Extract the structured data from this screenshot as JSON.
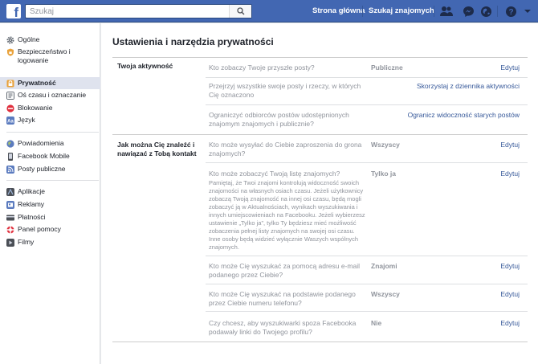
{
  "topbar": {
    "search_placeholder": "Szukaj",
    "nav_home": "Strona główna",
    "nav_find_friends": "Szukaj znajomych"
  },
  "sidebar": {
    "items": [
      {
        "label": "Ogólne"
      },
      {
        "label": "Bezpieczeństwo i logowanie"
      },
      {
        "label": "Prywatność"
      },
      {
        "label": "Oś czasu i oznaczanie"
      },
      {
        "label": "Blokowanie"
      },
      {
        "label": "Język"
      },
      {
        "label": "Powiadomienia"
      },
      {
        "label": "Facebook Mobile"
      },
      {
        "label": "Posty publiczne"
      },
      {
        "label": "Aplikacje"
      },
      {
        "label": "Reklamy"
      },
      {
        "label": "Płatności"
      },
      {
        "label": "Panel pomocy"
      },
      {
        "label": "Filmy"
      }
    ]
  },
  "main": {
    "title": "Ustawienia i narzędzia prywatności",
    "sections": [
      {
        "label": "Twoja aktywność",
        "rows": [
          {
            "question": "Kto zobaczy Twoje przyszłe posty?",
            "value": "Publiczne",
            "action": "Edytuj"
          },
          {
            "question": "Przejrzyj wszystkie swoje posty i rzeczy, w których Cię oznaczono",
            "value": "",
            "action": "Skorzystaj z dziennika aktywności"
          },
          {
            "question": "Ogranicźyć odbiorców postów udostępnionych znajomym znajomych i publicznie?",
            "value": "",
            "action": "Ogranicz widoczność starych postów"
          }
        ]
      },
      {
        "label": "Jak można Cię znaleźć i nawiązać z Tobą kontakt",
        "rows": [
          {
            "question": "Kto może wysyłać do Ciebie zaproszenia do grona znajomych?",
            "value": "Wszyscy",
            "action": "Edytuj"
          },
          {
            "question": "Kto może zobaczyć Twoją listę znajomych?",
            "description": "Pamiętaj, że Twoi znajomi kontrolują widoczność swoich znajomości na własnych osiach czasu. Jeżeli użytkownicy zobaczą Twoją znajomość na innej osi czasu, będą mogli zobaczyć ją w Aktualnościach, wynikach wyszukiwania i innych umiejscowieniach na Facebooku. Jeżeli wybierzesz ustawienie „Tylko ja”, tylko Ty będziesz mieć możliwość zobaczenia pełnej listy znajomych na swojej osi czasu. Inne osoby będą widzieć wyłącznie Waszych wspólnych znajomych.",
            "value": "Tylko ja",
            "action": "Edytuj"
          },
          {
            "question": "Kto może Cię wyszukać za pomocą adresu e-mail podanego przez Ciebie?",
            "value": "Znajomi",
            "action": "Edytuj"
          },
          {
            "question": "Kto może Cię wyszukać na podstawie podanego przez Ciebie numeru telefonu?",
            "value": "Wszyscy",
            "action": "Edytuj"
          },
          {
            "question": "Czy chcesz, aby wyszukiwarki spoza Facebooka podawały linki do Twojego profilu?",
            "value": "Nie",
            "action": "Edytuj"
          }
        ]
      }
    ]
  }
}
